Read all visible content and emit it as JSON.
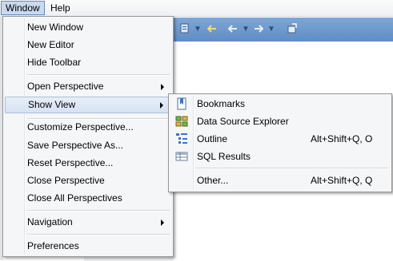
{
  "menubar": {
    "window_label": "Window",
    "help_label": "Help"
  },
  "window_menu": {
    "new_window": "New Window",
    "new_editor": "New Editor",
    "hide_toolbar": "Hide Toolbar",
    "open_perspective": "Open Perspective",
    "show_view": "Show View",
    "customize_perspective": "Customize Perspective...",
    "save_perspective_as": "Save Perspective As...",
    "reset_perspective": "Reset Perspective...",
    "close_perspective": "Close Perspective",
    "close_all_perspectives": "Close All Perspectives",
    "navigation": "Navigation",
    "preferences": "Preferences"
  },
  "show_view_menu": {
    "bookmarks": "Bookmarks",
    "data_source_explorer": "Data Source Explorer",
    "outline": "Outline",
    "outline_shortcut": "Alt+Shift+Q, O",
    "sql_results": "SQL Results",
    "other": "Other...",
    "other_shortcut": "Alt+Shift+Q, Q"
  },
  "icons": {
    "bookmarks": "bookmark-icon",
    "data_source_explorer": "database-explorer-icon",
    "outline": "outline-icon",
    "sql_results": "sql-results-icon"
  },
  "colors": {
    "highlight_border": "#a9c0e0",
    "toolbar_blue": "#6f99cd"
  }
}
